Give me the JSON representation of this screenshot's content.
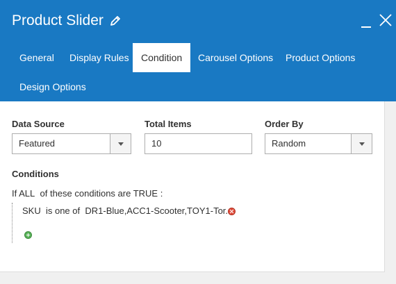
{
  "window": {
    "title": "Product Slider",
    "accent_color": "#1979c3"
  },
  "icons": {
    "title_edit": "pencil-icon",
    "minimize": "minimize-icon",
    "close": "close-icon"
  },
  "tabs": [
    {
      "label": "General",
      "active": false
    },
    {
      "label": "Display Rules",
      "active": false
    },
    {
      "label": "Condition",
      "active": true
    },
    {
      "label": "Carousel Options",
      "active": false
    },
    {
      "label": "Product Options",
      "active": false
    },
    {
      "label": "Design Options",
      "active": false
    }
  ],
  "form": {
    "data_source": {
      "label": "Data Source",
      "value": "Featured"
    },
    "total_items": {
      "label": "Total Items",
      "value": "10"
    },
    "order_by": {
      "label": "Order By",
      "value": "Random"
    }
  },
  "conditions": {
    "heading": "Conditions",
    "intro_if": "If",
    "aggregator": "ALL",
    "intro_mid": "of these conditions are",
    "value": "TRUE",
    "intro_end": ":",
    "rule": {
      "attribute": "SKU",
      "operator": "is one of",
      "value": "DR1-Blue,ACC1-Scooter,TOY1-Tor..."
    }
  }
}
